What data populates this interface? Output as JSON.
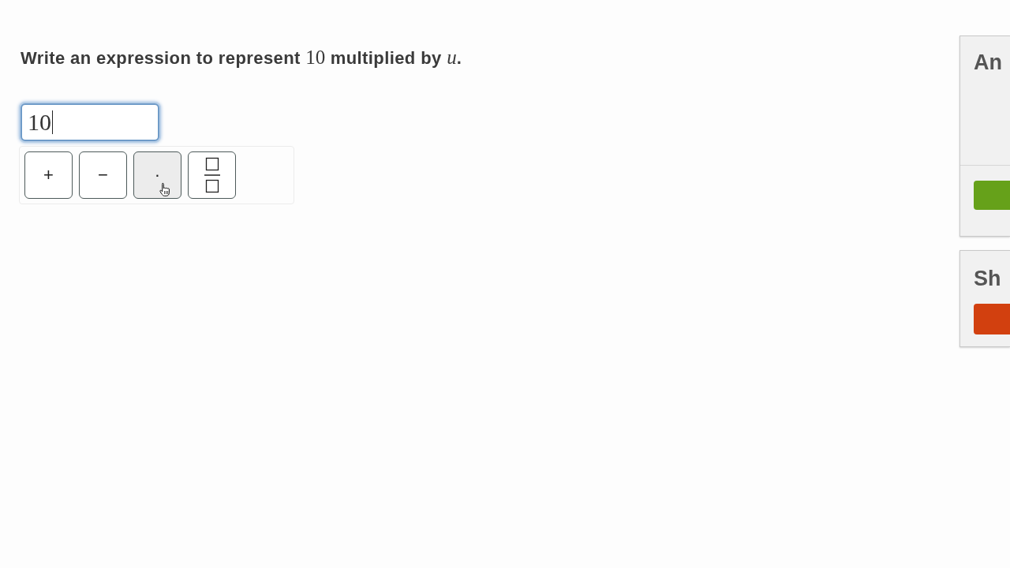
{
  "question": {
    "parts": [
      {
        "kind": "text",
        "text": "Write an expression to represent "
      },
      {
        "kind": "number",
        "text": "10"
      },
      {
        "kind": "text",
        "text": " multiplied by "
      },
      {
        "kind": "variable",
        "text": "u"
      },
      {
        "kind": "text",
        "text": "."
      }
    ]
  },
  "answer_field": {
    "value": "10",
    "focused": true
  },
  "keypad": {
    "keys": [
      {
        "kind": "symbol",
        "label": "+",
        "hovered": false
      },
      {
        "kind": "symbol",
        "label": "−",
        "hovered": false
      },
      {
        "kind": "symbol",
        "label": "·",
        "hovered": true
      },
      {
        "kind": "fraction",
        "hovered": false
      }
    ]
  },
  "side_panels": [
    {
      "kind": "answer",
      "title": "An",
      "color": "#66a11a"
    },
    {
      "kind": "hint",
      "title": "Sh",
      "color": "#d2400f"
    }
  ]
}
